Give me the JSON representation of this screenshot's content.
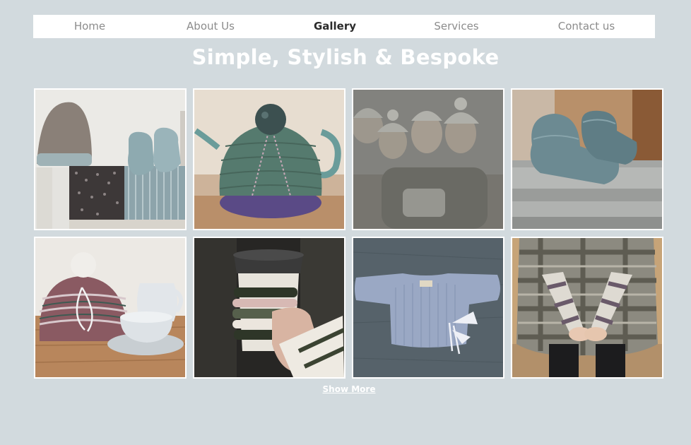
{
  "nav": {
    "items": [
      {
        "label": "Home"
      },
      {
        "label": "About Us"
      },
      {
        "label": "Gallery",
        "active": true
      },
      {
        "label": "Services"
      },
      {
        "label": "Contact us"
      }
    ]
  },
  "page": {
    "title": "Simple, Stylish & Bespoke"
  },
  "gallery": {
    "items": [
      {
        "subject": "knitted hat and baby booties"
      },
      {
        "subject": "knitted tea cosy on teapot"
      },
      {
        "subject": "women wearing knitted bobble hats"
      },
      {
        "subject": "knitted baby booties on blanket"
      },
      {
        "subject": "striped tea cosy with jug and cup"
      },
      {
        "subject": "knitted cup sleeve and fingerless glove"
      },
      {
        "subject": "knitted baby cardigan"
      },
      {
        "subject": "striped fingerless gloves"
      }
    ],
    "show_more_label": "Show More"
  },
  "colors": {
    "background": "#d2dade",
    "nav_bg": "#ffffff",
    "accent_text": "#ffffff"
  }
}
